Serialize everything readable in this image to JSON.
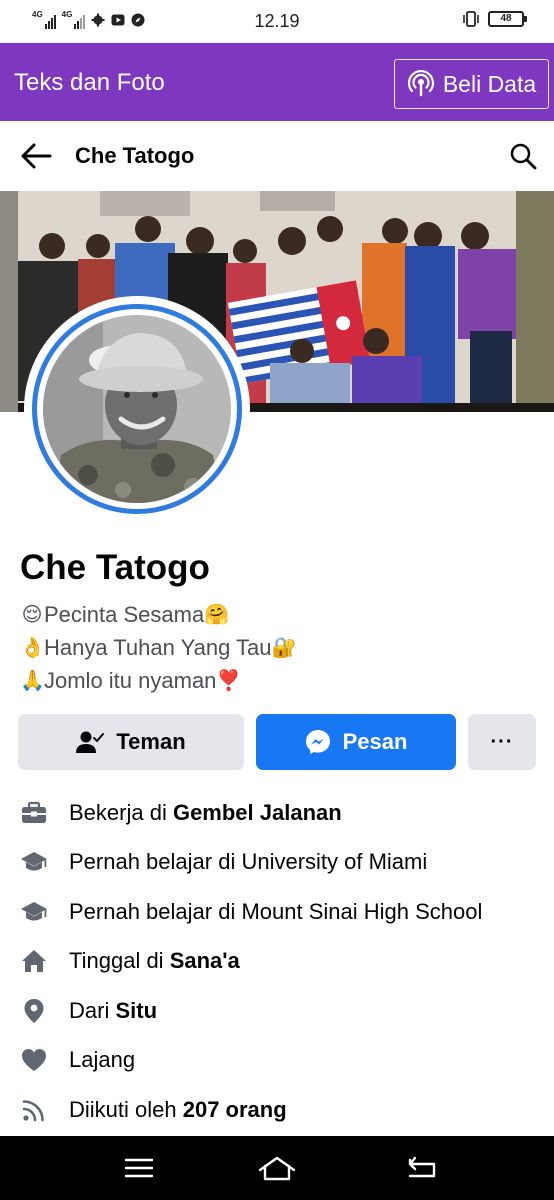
{
  "status_bar": {
    "network_1": "4G",
    "network_2": "4G",
    "time": "12.19",
    "battery": "48"
  },
  "data_banner": {
    "title": "Teks dan Foto",
    "buy_label": "Beli Data",
    "background": "#7e37bf"
  },
  "header": {
    "title": "Che Tatogo"
  },
  "profile": {
    "name": "Che Tatogo",
    "bio": [
      {
        "emoji": "😌",
        "text": "Pecinta Sesama",
        "trail": "🤗"
      },
      {
        "emoji": "👌",
        "text": "Hanya Tuhan Yang Tau",
        "trail": "🔐"
      },
      {
        "emoji": "🙏",
        "text": "Jomlo itu nyaman",
        "trail": "❣️"
      }
    ]
  },
  "actions": {
    "friends_label": "Teman",
    "message_label": "Pesan",
    "more_label": "···",
    "accent": "#1877f2"
  },
  "details": [
    {
      "icon": "briefcase-icon",
      "prefix": "Bekerja di ",
      "bold": "Gembel Jalanan"
    },
    {
      "icon": "graduation-cap-icon",
      "prefix": "Pernah belajar di University of Miami",
      "bold": ""
    },
    {
      "icon": "graduation-cap-icon",
      "prefix": "Pernah belajar di Mount Sinai High School",
      "bold": ""
    },
    {
      "icon": "home-icon",
      "prefix": "Tinggal di ",
      "bold": "Sana'a"
    },
    {
      "icon": "location-pin-icon",
      "prefix": "Dari ",
      "bold": "Situ"
    },
    {
      "icon": "heart-icon",
      "prefix": "Lajang",
      "bold": ""
    },
    {
      "icon": "rss-icon",
      "prefix": "Diikuti oleh ",
      "bold": "207 orang"
    }
  ],
  "nav": {
    "icons": [
      "menu-icon",
      "home-icon",
      "back-icon"
    ]
  }
}
